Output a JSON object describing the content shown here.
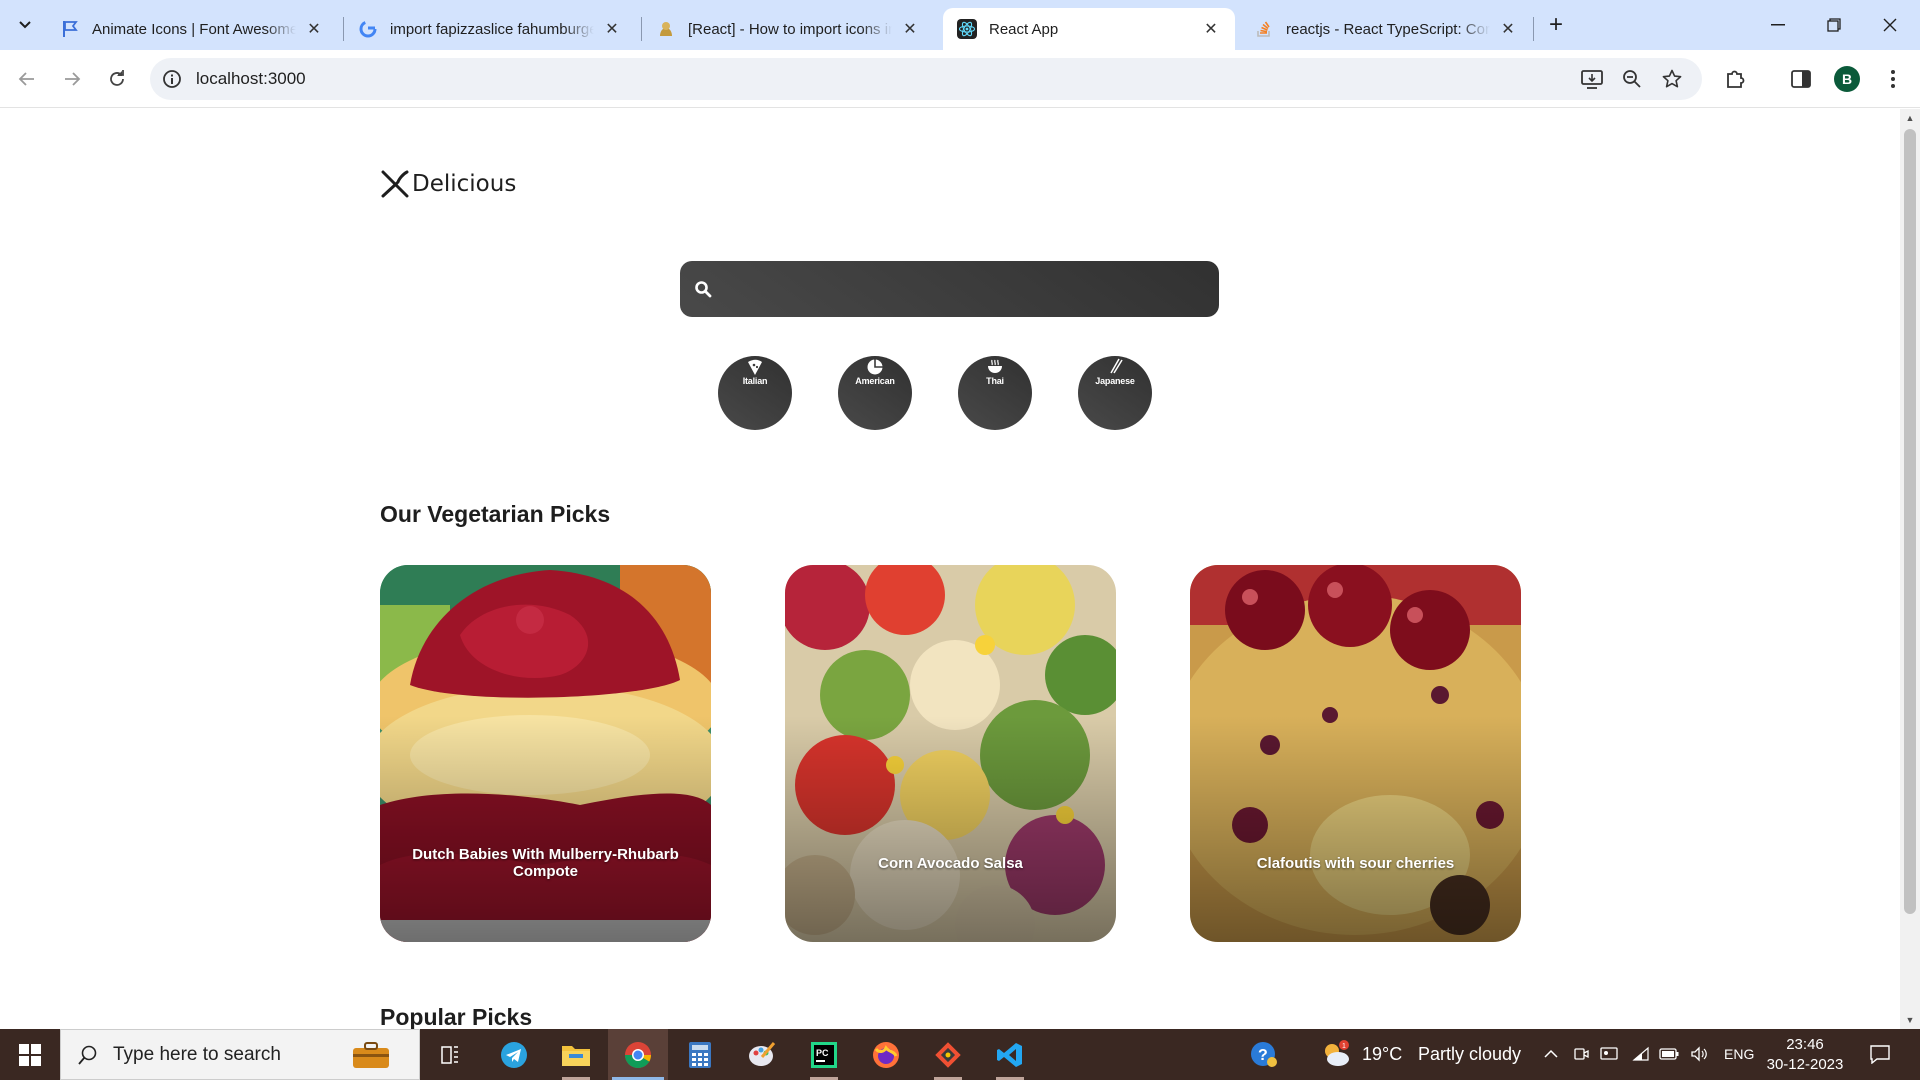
{
  "browser": {
    "tabs": [
      {
        "title": "Animate Icons | Font Awesome",
        "favicon": "flag-icon"
      },
      {
        "title": "import fapizzaslice fahumburger",
        "favicon": "google-icon"
      },
      {
        "title": "[React] - How to import icons in",
        "favicon": "forum-icon"
      },
      {
        "title": "React App",
        "favicon": "react-icon",
        "active": true
      },
      {
        "title": "reactjs - React TypeScript: Corre",
        "favicon": "stackoverflow-icon"
      }
    ],
    "url": "localhost:3000",
    "profile_initial": "B"
  },
  "app": {
    "logo_text": "Delicious",
    "search": {
      "placeholder": "",
      "value": ""
    },
    "cuisines": [
      {
        "label": "Italian",
        "icon": "pizza-icon"
      },
      {
        "label": "American",
        "icon": "hamburger-icon"
      },
      {
        "label": "Thai",
        "icon": "noodles-icon"
      },
      {
        "label": "Japanese",
        "icon": "chopsticks-icon"
      }
    ],
    "sections": {
      "veggie_title": "Our Vegetarian Picks",
      "popular_title": "Popular Picks"
    },
    "veggie_cards": [
      {
        "title": "Dutch Babies With Mulberry-Rhubarb Compote"
      },
      {
        "title": "Corn Avocado Salsa"
      },
      {
        "title": "Clafoutis with sour cherries"
      }
    ]
  },
  "taskbar": {
    "search_placeholder": "Type here to search",
    "weather_temp": "19°C",
    "weather_desc": "Partly cloudy",
    "language": "ENG",
    "time": "23:46",
    "date": "30-12-2023"
  },
  "colors": {
    "accent_dark": "#313131",
    "tabstrip": "#d3e3fd",
    "taskbar": "#3a2822"
  }
}
